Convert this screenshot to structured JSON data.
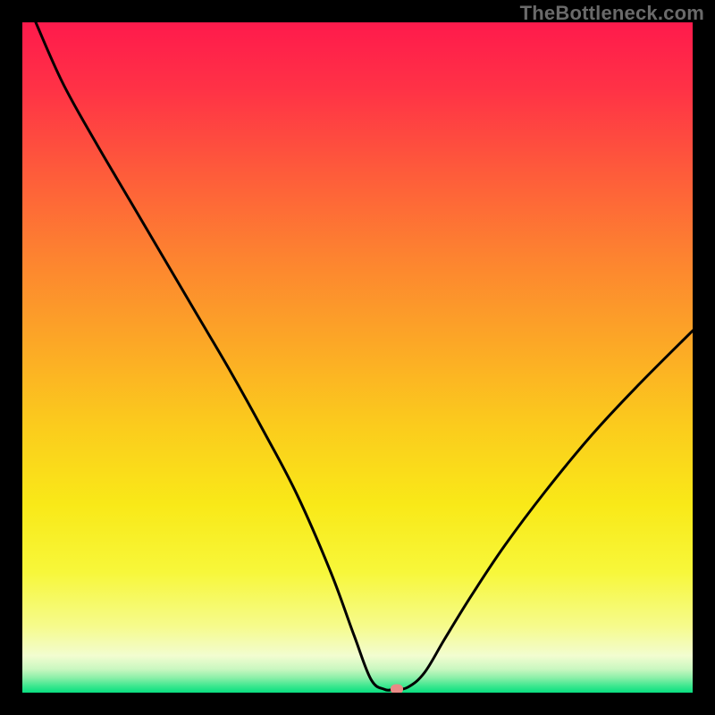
{
  "attribution": "TheBottleneck.com",
  "chart_data": {
    "type": "line",
    "title": "",
    "xlabel": "",
    "ylabel": "",
    "xlim": [
      0,
      100
    ],
    "ylim": [
      0,
      100
    ],
    "grid": false,
    "legend": false,
    "background_gradient_stops": [
      {
        "pos": 0.0,
        "color": "#ff1a4c"
      },
      {
        "pos": 0.1,
        "color": "#ff3246"
      },
      {
        "pos": 0.22,
        "color": "#fe5a3b"
      },
      {
        "pos": 0.35,
        "color": "#fd8330"
      },
      {
        "pos": 0.48,
        "color": "#fca826"
      },
      {
        "pos": 0.6,
        "color": "#fbcb1d"
      },
      {
        "pos": 0.72,
        "color": "#f9e918"
      },
      {
        "pos": 0.82,
        "color": "#f7f73a"
      },
      {
        "pos": 0.9,
        "color": "#f6fb8b"
      },
      {
        "pos": 0.945,
        "color": "#f2fdd0"
      },
      {
        "pos": 0.965,
        "color": "#c9f7c0"
      },
      {
        "pos": 0.978,
        "color": "#8aefa8"
      },
      {
        "pos": 0.99,
        "color": "#3de78f"
      },
      {
        "pos": 1.0,
        "color": "#08df80"
      }
    ],
    "series": [
      {
        "name": "bottleneck-curve",
        "color": "#000000",
        "x": [
          2.0,
          6.0,
          11.0,
          16.0,
          21.0,
          26.0,
          31.0,
          36.0,
          41.0,
          46.0,
          49.5,
          52.0,
          54.0,
          55.5,
          57.5,
          60.0,
          63.0,
          67.0,
          72.0,
          78.0,
          85.0,
          92.0,
          100.0
        ],
        "y": [
          100.0,
          91.0,
          82.0,
          73.5,
          65.0,
          56.5,
          48.0,
          39.0,
          29.5,
          18.0,
          8.5,
          2.0,
          0.5,
          0.5,
          0.8,
          3.0,
          8.0,
          14.5,
          22.0,
          30.0,
          38.5,
          46.0,
          54.0
        ]
      }
    ],
    "marker": {
      "x": 55.8,
      "y": 0.6,
      "color": "#e98a86"
    }
  }
}
